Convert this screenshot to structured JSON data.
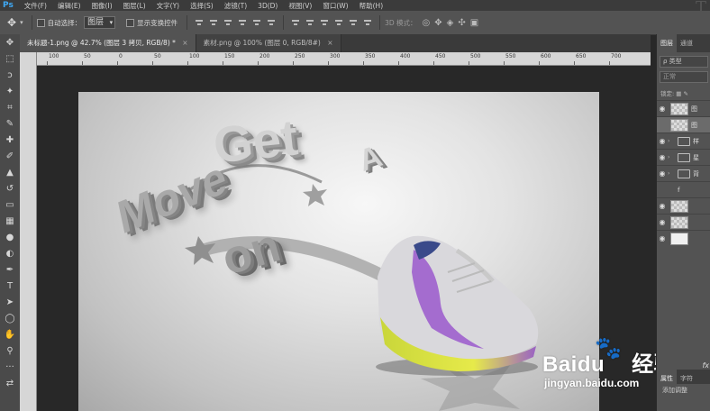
{
  "app": {
    "logo": "Ps",
    "corner_glyph": "T"
  },
  "menu": [
    "文件(F)",
    "编辑(E)",
    "图像(I)",
    "图层(L)",
    "文字(Y)",
    "选择(S)",
    "滤镜(T)",
    "3D(D)",
    "视图(V)",
    "窗口(W)",
    "帮助(H)"
  ],
  "options": {
    "move_icon": "✥",
    "auto_select_label": "自动选择：",
    "auto_select_value": "图层",
    "show_transform_label": "显示变换控件",
    "mode_3d_label": "3D 模式："
  },
  "document_tabs": [
    {
      "label": "未标题-1.png @ 42.7% (图层 3 拷贝, RGB/8) *",
      "active": true
    },
    {
      "label": "素材.png @ 100% (图层 0, RGB/8#)",
      "active": false
    }
  ],
  "ruler": {
    "labels": [
      "100",
      "50",
      "0",
      "50",
      "100",
      "150",
      "200",
      "250",
      "300",
      "350",
      "400",
      "450",
      "500",
      "550",
      "600",
      "650",
      "700"
    ]
  },
  "tools": [
    {
      "name": "move-tool-icon",
      "glyph": "✥"
    },
    {
      "name": "marquee-tool-icon",
      "glyph": "⬚"
    },
    {
      "name": "lasso-tool-icon",
      "glyph": "ↄ"
    },
    {
      "name": "magic-wand-tool-icon",
      "glyph": "✦"
    },
    {
      "name": "crop-tool-icon",
      "glyph": "⌗"
    },
    {
      "name": "eyedropper-tool-icon",
      "glyph": "✎"
    },
    {
      "name": "healing-tool-icon",
      "glyph": "✚"
    },
    {
      "name": "brush-tool-icon",
      "glyph": "✐"
    },
    {
      "name": "stamp-tool-icon",
      "glyph": "▲"
    },
    {
      "name": "history-brush-tool-icon",
      "glyph": "↺"
    },
    {
      "name": "eraser-tool-icon",
      "glyph": "▭"
    },
    {
      "name": "gradient-tool-icon",
      "glyph": "▦"
    },
    {
      "name": "blur-tool-icon",
      "glyph": "●"
    },
    {
      "name": "dodge-tool-icon",
      "glyph": "◐"
    },
    {
      "name": "pen-tool-icon",
      "glyph": "✒"
    },
    {
      "name": "type-tool-icon",
      "glyph": "T"
    },
    {
      "name": "path-selection-tool-icon",
      "glyph": "➤"
    },
    {
      "name": "shape-tool-icon",
      "glyph": "◯"
    },
    {
      "name": "hand-tool-icon",
      "glyph": "✋"
    },
    {
      "name": "zoom-tool-icon",
      "glyph": "⚲"
    },
    {
      "name": "more-tools-icon",
      "glyph": "···"
    },
    {
      "name": "swap-colors-icon",
      "glyph": "⇄"
    }
  ],
  "canvas_art": {
    "word_get": "Get",
    "word_a": "A",
    "word_move": "Move",
    "word_on": "on"
  },
  "layers_panel": {
    "tabs": [
      "图层",
      "通道"
    ],
    "filter_label": "ρ 类型",
    "blend_mode": "正常",
    "lock_label": "锁定:",
    "layers": [
      {
        "type": "image",
        "visible": true,
        "name": "图"
      },
      {
        "type": "image",
        "visible": false,
        "name": "图",
        "selected": true
      },
      {
        "type": "group",
        "visible": true,
        "name": "样"
      },
      {
        "type": "group",
        "visible": true,
        "name": "星"
      },
      {
        "type": "group",
        "visible": true,
        "name": "背"
      },
      {
        "type": "effect",
        "visible": false,
        "name": "f"
      },
      {
        "type": "image",
        "visible": true,
        "name": ""
      },
      {
        "type": "image",
        "visible": true,
        "name": ""
      },
      {
        "type": "white",
        "visible": true,
        "name": ""
      }
    ],
    "fx_label": "fx",
    "bottom_tabs": [
      "属性",
      "字符"
    ],
    "add_adjustment": "添加调整"
  },
  "watermark": {
    "brand": "Baidu",
    "brand_cn": "经验",
    "url": "jingyan.baidu.com"
  }
}
